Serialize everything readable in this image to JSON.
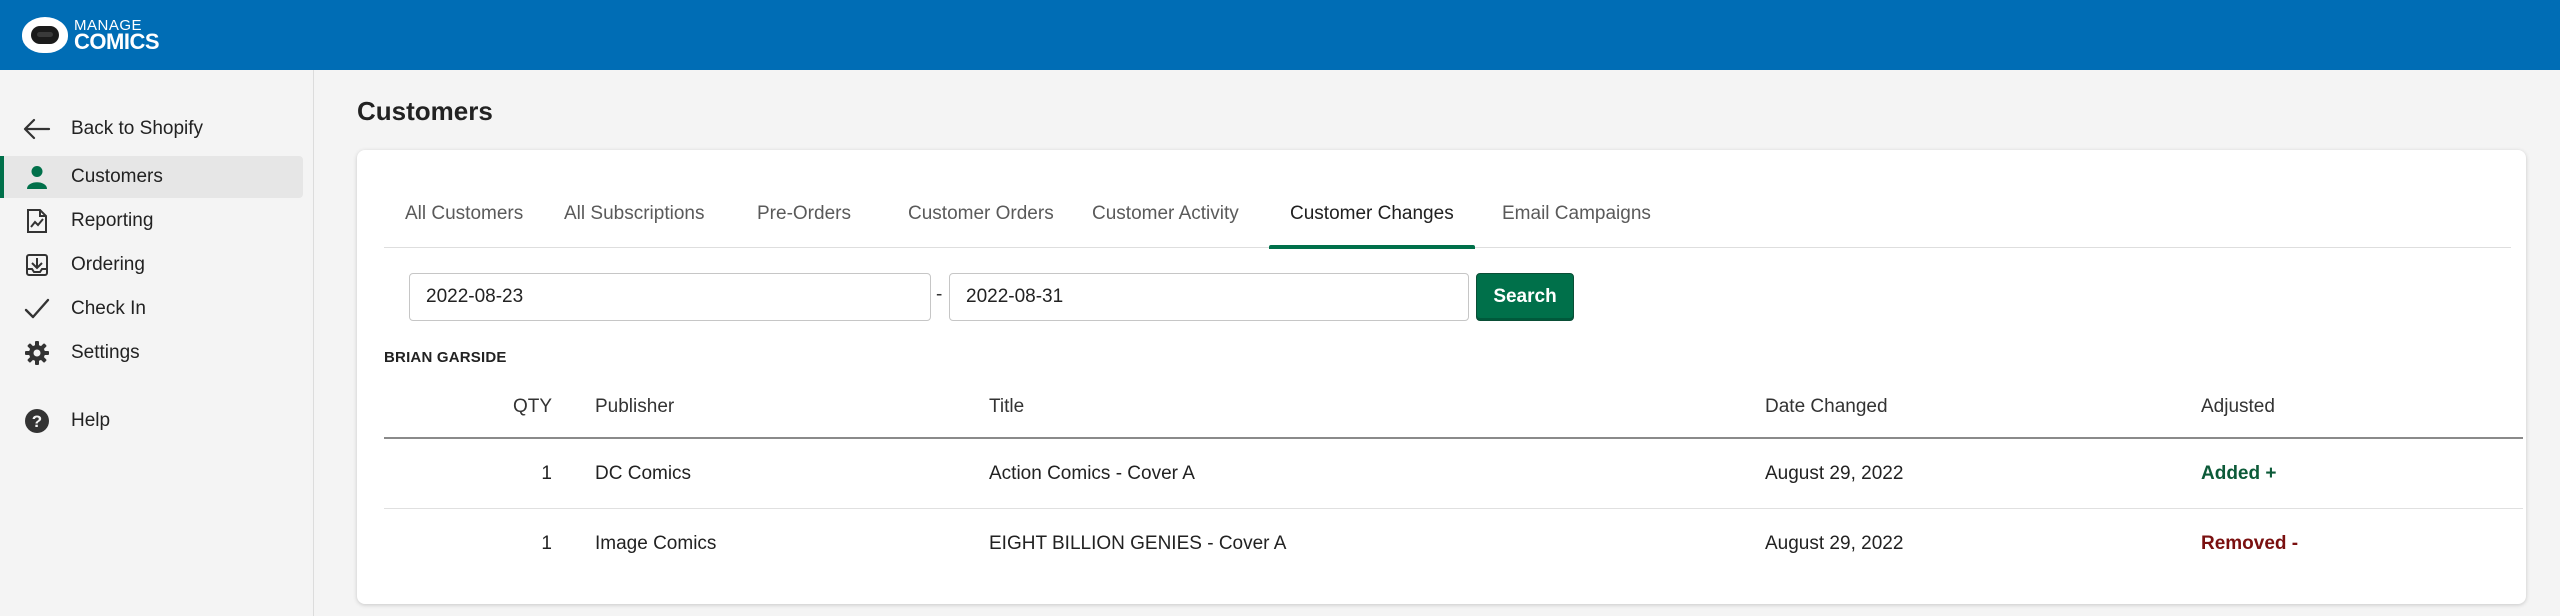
{
  "brand": {
    "line1": "MANAGE",
    "line2": "COMICS"
  },
  "sidebar": {
    "back": "Back to Shopify",
    "items": [
      {
        "label": "Customers",
        "icon": "person-icon",
        "active": true
      },
      {
        "label": "Reporting",
        "icon": "report-icon"
      },
      {
        "label": "Ordering",
        "icon": "download-tray-icon"
      },
      {
        "label": "Check In",
        "icon": "check-icon"
      },
      {
        "label": "Settings",
        "icon": "gear-icon"
      }
    ],
    "help": "Help"
  },
  "page": {
    "title": "Customers"
  },
  "tabs": [
    {
      "label": "All Customers"
    },
    {
      "label": "All Subscriptions"
    },
    {
      "label": "Pre-Orders"
    },
    {
      "label": "Customer Orders"
    },
    {
      "label": "Customer Activity"
    },
    {
      "label": "Customer Changes",
      "active": true
    },
    {
      "label": "Email Campaigns"
    }
  ],
  "filter": {
    "start_date": "2022-08-23",
    "separator": "-",
    "end_date": "2022-08-31",
    "search_label": "Search"
  },
  "customer": {
    "name": "BRIAN GARSIDE"
  },
  "table": {
    "headers": {
      "qty": "QTY",
      "publisher": "Publisher",
      "title": "Title",
      "date": "Date Changed",
      "adjusted": "Adjusted"
    },
    "rows": [
      {
        "qty": "1",
        "publisher": "DC Comics",
        "title": "Action Comics - Cover A",
        "date": "August 29, 2022",
        "adjusted": "Added +"
      },
      {
        "qty": "1",
        "publisher": "Image Comics",
        "title": "EIGHT BILLION GENIES - Cover A",
        "date": "August 29, 2022",
        "adjusted": "Removed -"
      }
    ]
  },
  "colors": {
    "topbar": "#006db5",
    "accent": "#00704a",
    "added": "#0c5a38",
    "removed": "#7a1010"
  }
}
